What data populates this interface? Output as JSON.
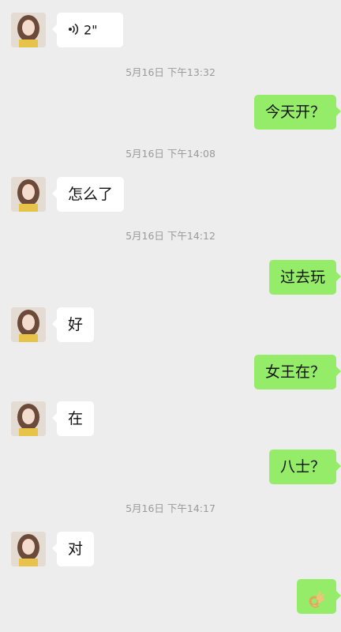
{
  "colors": {
    "background": "#ededed",
    "incoming_bubble": "#ffffff",
    "outgoing_bubble": "#95ec69",
    "timestamp_text": "#9a9a9a"
  },
  "messages": [
    {
      "kind": "incoming-voice",
      "duration": "2\"",
      "icon": "voice-wave-icon"
    },
    {
      "kind": "timestamp",
      "text": "5月16日 下午13:32"
    },
    {
      "kind": "outgoing",
      "text": "今天开？"
    },
    {
      "kind": "timestamp",
      "text": "5月16日 下午14:08"
    },
    {
      "kind": "incoming",
      "text": "怎么了"
    },
    {
      "kind": "timestamp",
      "text": "5月16日 下午14:12"
    },
    {
      "kind": "outgoing",
      "text": "过去玩"
    },
    {
      "kind": "incoming",
      "text": "好"
    },
    {
      "kind": "outgoing",
      "text": "女王在？"
    },
    {
      "kind": "incoming",
      "text": "在"
    },
    {
      "kind": "outgoing",
      "text": "八士？"
    },
    {
      "kind": "timestamp",
      "text": "5月16日 下午14:17"
    },
    {
      "kind": "incoming",
      "text": "对"
    },
    {
      "kind": "outgoing-emoji",
      "icon": "ok-hand-emoji-icon"
    }
  ]
}
